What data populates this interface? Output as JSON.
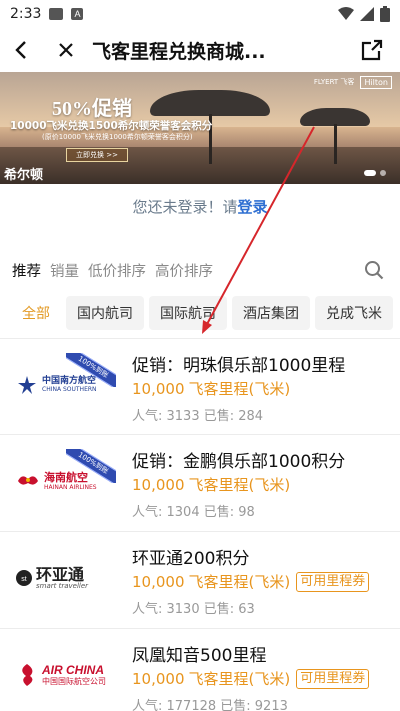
{
  "status_bar": {
    "time": "2:33",
    "left_icons": [
      "image-icon",
      "a-icon"
    ],
    "right_icons": [
      "wifi-icon",
      "signal-icon",
      "battery-icon"
    ]
  },
  "header": {
    "title": "飞客里程兑换商城...",
    "back_icon": "back-arrow-icon",
    "close_icon": "close-icon",
    "share_icon": "share-icon"
  },
  "banner": {
    "headline": "50%促销",
    "subline": "10000飞米兑换1500希尔顿荣誉客会积分",
    "note": "(原价10000飞米兑换1000希尔顿荣誉客会积分)",
    "cta_label": "立即兑换 >>",
    "brand_text": "希尔顿",
    "partner_logo_1": "FLYERT 飞客",
    "partner_logo_2": "Hilton"
  },
  "login_hint": {
    "prefix": "您还未登录！请",
    "link": "登录"
  },
  "sort_tabs": [
    {
      "label": "推荐",
      "active": true
    },
    {
      "label": "销量",
      "active": false
    },
    {
      "label": "低价排序",
      "active": false
    },
    {
      "label": "高价排序",
      "active": false
    }
  ],
  "categories": [
    {
      "label": "全部",
      "active": true
    },
    {
      "label": "国内航司",
      "active": false
    },
    {
      "label": "国际航司",
      "active": false
    },
    {
      "label": "酒店集团",
      "active": false
    },
    {
      "label": "兑成飞米",
      "active": false
    }
  ],
  "products": [
    {
      "title": "促销：明珠俱乐部1000里程",
      "price": "10,000",
      "price_unit": "飞客里程(飞米)",
      "coupon": "",
      "stats": "人气: 3133 已售: 284",
      "ribbon": "100%到账",
      "logo_main": "中国南方航空",
      "logo_sub": "CHINA SOUTHERN",
      "logo_color": "#223f93"
    },
    {
      "title": "促销：金鹏俱乐部1000积分",
      "price": "10,000",
      "price_unit": "飞客里程(飞米)",
      "coupon": "",
      "stats": "人气: 1304 已售: 98",
      "ribbon": "100%到账",
      "logo_main": "海南航空",
      "logo_sub": "HAINAN AIRLINES",
      "logo_color": "#c8102e"
    },
    {
      "title": "环亚通200积分",
      "price": "10,000",
      "price_unit": "飞客里程(飞米)",
      "coupon": "可用里程券",
      "stats": "人气: 3130 已售: 63",
      "ribbon": "",
      "logo_main": "环亚通",
      "logo_sub": "smart traveller",
      "logo_color": "#222222"
    },
    {
      "title": "凤凰知音500里程",
      "price": "10,000",
      "price_unit": "飞客里程(飞米)",
      "coupon": "可用里程券",
      "stats": "人气: 177128 已售: 9213",
      "ribbon": "",
      "logo_main": "AIR CHINA",
      "logo_sub": "中国国际航空公司",
      "logo_color": "#c8102e"
    }
  ],
  "colors": {
    "accent_orange": "#e8951e",
    "link_blue": "#2f6fd2",
    "annotation_red": "#d6262b"
  }
}
